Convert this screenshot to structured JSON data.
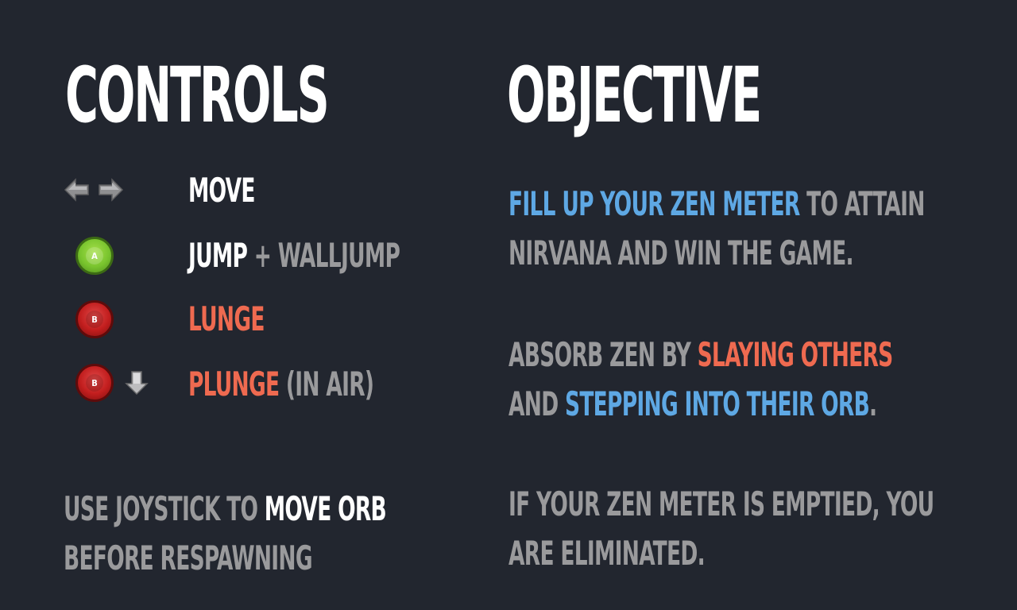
{
  "controls": {
    "title": "CONTROLS",
    "rows": [
      {
        "icons": [
          "arrow-left-icon",
          "arrow-right-icon"
        ],
        "label": "MOVE",
        "extra": ""
      },
      {
        "icons": [
          "a-button-icon"
        ],
        "button_letter": "A",
        "label": "JUMP",
        "extra": "+ WALLJUMP"
      },
      {
        "icons": [
          "b-button-icon"
        ],
        "button_letter": "B",
        "label": "LUNGE",
        "extra": ""
      },
      {
        "icons": [
          "b-button-icon",
          "arrow-down-icon"
        ],
        "button_letter": "B",
        "label": "PLUNGE",
        "extra": "(IN AIR)"
      }
    ],
    "respawn": {
      "line1_grey": "USE JOYSTICK TO",
      "line1_white": "MOVE ORB",
      "line2_grey": "BEFORE RESPAWNING"
    }
  },
  "objective": {
    "title": "OBJECTIVE",
    "p1": {
      "line1_blue": "FILL UP YOUR ZEN METER",
      "line1_grey": "TO ATTAIN",
      "line2_grey": "NIRVANA AND WIN THE GAME."
    },
    "p2": {
      "line1_grey": "ABSORB ZEN BY",
      "line1_red": "SLAYING OTHERS",
      "line2_grey": "AND",
      "line2_blue": "STEPPING INTO THEIR ORB",
      "line2_end": "."
    },
    "p3": {
      "line1_grey": "IF YOUR ZEN METER IS EMPTIED, YOU",
      "line2_grey": "ARE ELIMINATED."
    }
  },
  "colors": {
    "background": "#22262f",
    "white": "#ffffff",
    "grey": "#9a9a9c",
    "red": "#ef6a50",
    "blue": "#5ea8e4",
    "button_a": "#79c42e",
    "button_b": "#c21e1e"
  }
}
